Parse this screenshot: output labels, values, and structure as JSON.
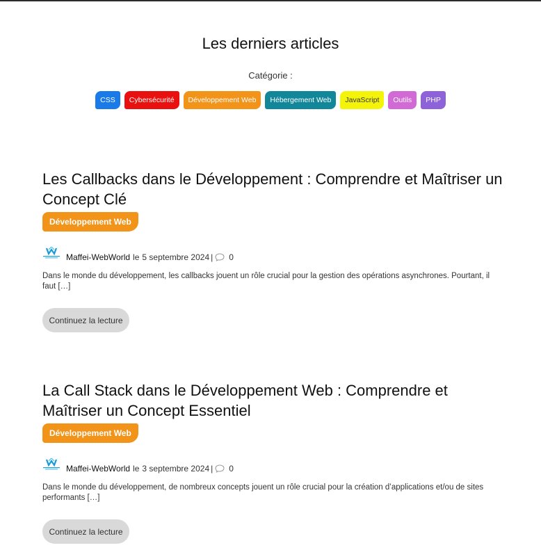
{
  "section": {
    "title": "Les derniers articles",
    "category_label": "Catégorie :"
  },
  "categories": [
    {
      "label": "CSS",
      "color": "#1a7be8"
    },
    {
      "label": "Cybersécurité",
      "color": "#e8110f"
    },
    {
      "label": "Développement Web",
      "color": "#f2931a"
    },
    {
      "label": "Hébergement Web",
      "color": "#13879a"
    },
    {
      "label": "JavaScript",
      "color": "#f4f40a",
      "text_color": "#333333"
    },
    {
      "label": "Outils",
      "color": "#d26ad6"
    },
    {
      "label": "PHP",
      "color": "#8e62d8"
    }
  ],
  "articles": [
    {
      "title": "Les Callbacks dans le Développement : Comprendre et Maîtriser un Concept Clé",
      "badge": "Développement Web",
      "author": "Maffei-WebWorld",
      "date_prefix": "le",
      "date": "5 septembre 2024",
      "separator": "|",
      "comments": "0",
      "excerpt": "Dans le monde du développement, les callbacks jouent un rôle crucial pour la gestion des opérations asynchrones. Pourtant, il faut […]",
      "read_more": "Continuez la lecture"
    },
    {
      "title": "La Call Stack dans le Développement Web : Comprendre et Maîtriser un Concept Essentiel",
      "badge": "Développement Web",
      "author": "Maffei-WebWorld",
      "date_prefix": "le",
      "date": "3 septembre 2024",
      "separator": "|",
      "comments": "0",
      "excerpt": "Dans le monde du développement, de nombreux concepts jouent un rôle crucial pour la création d’applications et/ou de sites performants […]",
      "read_more": "Continuez la lecture"
    }
  ],
  "icons": {
    "avatar": "maffei-webworld-logo-icon",
    "comment": "comment-bubble-icon"
  },
  "colors": {
    "badge": "#f2931a",
    "read_more_bg": "#d9d9d9",
    "logo_blue": "#1a9bd8"
  }
}
